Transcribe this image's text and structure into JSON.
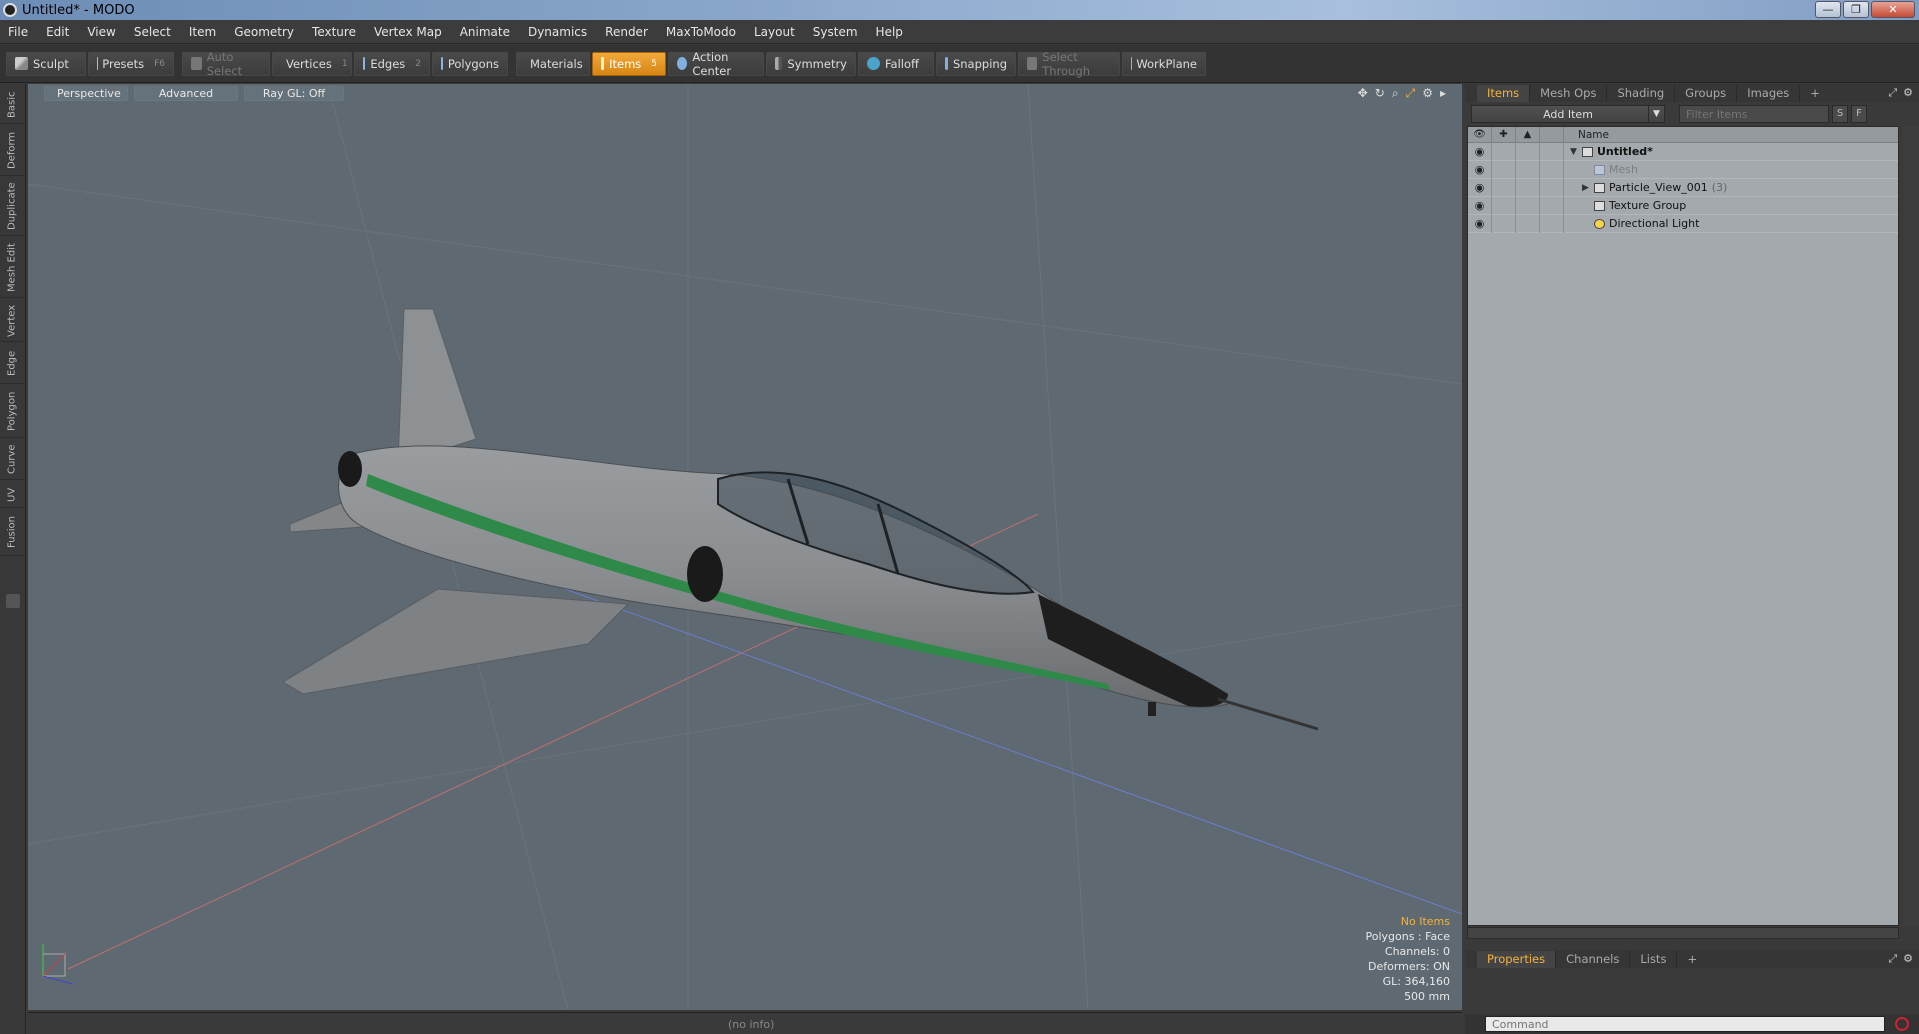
{
  "window": {
    "title": "Untitled* - MODO",
    "min": "—",
    "max": "❐",
    "close": "✕"
  },
  "menu": [
    "File",
    "Edit",
    "View",
    "Select",
    "Item",
    "Geometry",
    "Texture",
    "Vertex Map",
    "Animate",
    "Dynamics",
    "Render",
    "MaxToModo",
    "Layout",
    "System",
    "Help"
  ],
  "toolbar": {
    "sculpt": "Sculpt",
    "presets": "Presets",
    "presets_key": "F6",
    "auto_select": "Auto Select",
    "vertices": "Vertices",
    "vertices_key": "1",
    "edges": "Edges",
    "edges_key": "2",
    "polygons": "Polygons",
    "materials": "Materials",
    "items": "Items",
    "items_key": "5",
    "action_center": "Action Center",
    "symmetry": "Symmetry",
    "falloff": "Falloff",
    "snapping": "Snapping",
    "select_through": "Select Through",
    "workplane": "WorkPlane"
  },
  "left_tabs": [
    "Basic",
    "Deform",
    "Duplicate",
    "Mesh Edit",
    "Vertex",
    "Edge",
    "Polygon",
    "Curve",
    "UV",
    "Fusion"
  ],
  "viewport": {
    "tabs": [
      "Perspective",
      "Advanced",
      "Ray GL: Off"
    ],
    "info": {
      "selection": "No Items",
      "polygons": "Polygons : Face",
      "channels": "Channels: 0",
      "deformers": "Deformers: ON",
      "gl": "GL: 364,160",
      "scale": "500 mm"
    }
  },
  "status": {
    "info": "(no info)"
  },
  "right_panel": {
    "top_tabs": [
      "Items",
      "Mesh Ops",
      "Shading",
      "Groups",
      "Images"
    ],
    "add_item": "Add Item",
    "filter_placeholder": "Filter Items",
    "s_btn": "S",
    "f_btn": "F",
    "name_header": "Name",
    "items": [
      {
        "label": "Untitled*",
        "count": ""
      },
      {
        "label": "Mesh",
        "count": ""
      },
      {
        "label": "Particle_View_001",
        "count": "(3)"
      },
      {
        "label": "Texture Group",
        "count": ""
      },
      {
        "label": "Directional Light",
        "count": ""
      }
    ],
    "bottom_tabs": [
      "Properties",
      "Channels",
      "Lists"
    ],
    "command_placeholder": "Command"
  },
  "colors": {
    "accent": "#f3b340",
    "viewport_bg": "#5e6972",
    "stripe": "#2f8a4a"
  }
}
